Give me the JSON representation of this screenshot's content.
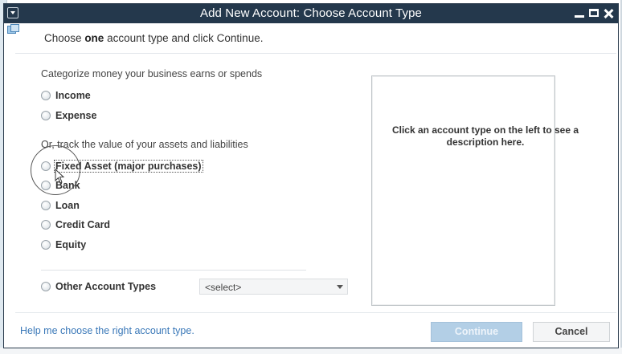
{
  "window": {
    "title": "Add New Account: Choose Account Type"
  },
  "instruction": {
    "prefix": "Choose",
    "emphasis": "one",
    "suffix": "account type and click Continue."
  },
  "sections": {
    "categorize_label": "Categorize money your business earns or spends",
    "track_label": "Or, track the value of your assets and liabilities"
  },
  "account_types": {
    "income": "Income",
    "expense": "Expense",
    "fixed_asset": "Fixed Asset (major purchases)",
    "bank": "Bank",
    "loan": "Loan",
    "credit_card": "Credit Card",
    "equity": "Equity",
    "other": "Other Account Types"
  },
  "other_select": {
    "value": "<select>"
  },
  "description": {
    "text": "Click an account type on the left to see a description here."
  },
  "footer": {
    "help_link": "Help me choose the right account type.",
    "continue_label": "Continue",
    "cancel_label": "Cancel"
  },
  "colors": {
    "titlebar": "#24384c",
    "link": "#3a78b8",
    "continue_disabled": "#b3cfe6"
  },
  "icons": {
    "system_menu": "dropdown-arrow-icon",
    "minimize": "minimize-icon",
    "maximize": "maximize-icon",
    "close": "close-icon",
    "app": "quickbooks-window-icon",
    "select_chevron": "chevron-down-icon",
    "mouse_cursor": "mouse-pointer-icon"
  }
}
